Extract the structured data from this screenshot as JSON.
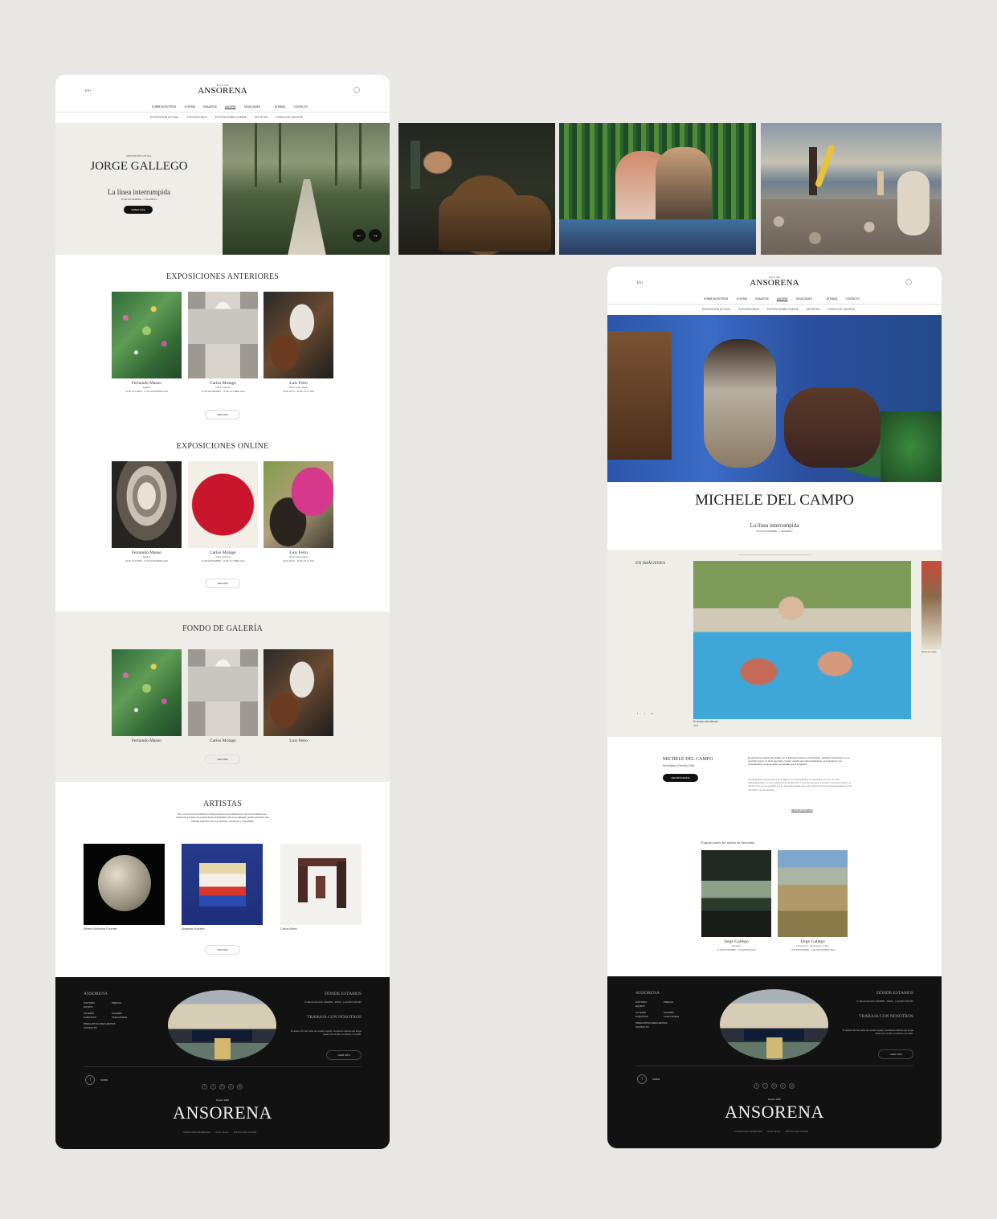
{
  "left_page": {
    "header": {
      "lang": "ES+",
      "logo_small": "SALA DE",
      "logo": "ANSORENA",
      "nav": [
        "SOBRE NOSOTROS",
        "JOYERÍA",
        "SUBASTAS",
        "GALERÍA",
        "TASACIONES",
        "ATIENDA",
        "CONTACTO"
      ],
      "subnav": [
        "EXPOSICIÓN ACTUAL",
        "EXPOSICIONES",
        "EXPOSICIONES ONLINE",
        "ARTISTAS",
        "FONDO DE GALERÍA"
      ]
    },
    "hero": {
      "kicker": "EXPOSICIÓN ACTUAL",
      "artist": "JORGE GALLEGO",
      "title": "La línea interrumpida",
      "dates": "25 DE NOVIEMBRE - 7 DE ENERO",
      "button": "SABER MÁS",
      "prev": "←",
      "next": "→"
    },
    "anteriores": {
      "title": "EXPOSICIONES ANTERIORES",
      "cards": [
        {
          "name": "Fernando Manso",
          "sub": "Agalico",
          "date": "18 DE OCTUBRE - 13 DE NOVIEMBRE 2023"
        },
        {
          "name": "Carlos Motago",
          "sub": "Obra reciente",
          "date": "12 DE SEPTIEMBRE - 13 DE OCTUBRE 2023"
        },
        {
          "name": "Luis Feito",
          "sub": "Obra sobre papel",
          "date": "18 DE MAYO - 30 DE JULIO 2023"
        }
      ],
      "button": "VER MÁS"
    },
    "online": {
      "title": "EXPOSICIONES ONLINE",
      "cards": [
        {
          "name": "Fernando Manso",
          "sub": "Agalico",
          "date": "18 DE OCTUBRE - 13 DE NOVIEMBRE 2023"
        },
        {
          "name": "Carlos Motago",
          "sub": "Obra reciente",
          "date": "12 DE SEPTIEMBRE - 13 DE OCTUBRE 2023"
        },
        {
          "name": "Luis Feito",
          "sub": "Obra sobre papel",
          "date": "18 DE MAYO - 30 DE JULIO 2023"
        }
      ],
      "button": "VER MÁS"
    },
    "fondo": {
      "title": "FONDO DE GALERÍA",
      "cards": [
        {
          "name": "Fernando Manso"
        },
        {
          "name": "Carlos Motago"
        },
        {
          "name": "Luis Feito"
        }
      ],
      "button": "VER MÁS"
    },
    "artistas": {
      "title": "ARTISTAS",
      "intro": "Son numerosos los artistas contemporáneos que colaboraron de forma habitual con Ansorena a través de exposiciones individuales. En este apartado podrá encontrar una cuidada selección de sus pinturas, esculturas y fotografías.",
      "items": [
        "Alberto Bañuelos Fournier",
        "Alejandro Botubol",
        "Carlos Albert"
      ],
      "button": "VER MÁS"
    }
  },
  "footer": {
    "brand": "ANSORENA",
    "links_col1": [
      "HISTORIA",
      "EQUIPO",
      "JOYERÍA",
      "SUBASTAS",
      "PREGUNTAS FRECUENTES",
      "CONTACTO"
    ],
    "links_col2": [
      "PRENSA",
      "GALERÍA",
      "TASACIONES"
    ],
    "where_title": "DÓNDE ESTAMOS",
    "address": "C/ DE ALCALÁ 52, MADRID · 28014 · (+34) 915 328 515",
    "work_title": "TRABAJA CON NOSOTROS",
    "work_text": "Si quieres formar parte de nuestro equipo, buscamos talento que tenga pasión por el arte, la cultura y el estilo.",
    "work_button": "LEER MÁS",
    "up_label": "SUBIR",
    "social": [
      "f",
      "t",
      "in",
      "p",
      "ig"
    ],
    "since": "Desde 1845",
    "logo": "ANSORENA",
    "legal": [
      "CONDICIONES GENERALES",
      "AVISO LEGAL",
      "POLÍTICA DE COOKIES"
    ]
  },
  "right_page": {
    "header": {
      "lang": "ES+",
      "logo_small": "SALA DE",
      "logo": "ANSORENA",
      "nav": [
        "SOBRE NOSOTROS",
        "JOYERÍA",
        "SUBASTAS",
        "GALERÍA",
        "TASACIONES",
        "ATIENDA",
        "CONTACTO"
      ],
      "subnav": [
        "EXPOSICIÓN ACTUAL",
        "EXPOSICIONES",
        "EXPOSICIONES ONLINE",
        "ARTISTAS",
        "FONDO DE GALERÍA"
      ]
    },
    "artist": "MICHELE DEL CAMPO",
    "exhibition": "La línea interrumpida",
    "dates": "25 DE NOVIEMBRE - 7 DE ENERO",
    "images_label": "EN IMÁGENES",
    "caption": "El susurro del silencio",
    "caption_year": "2018",
    "caption2": "Obra sin título",
    "bio_name": "MICHELE DEL CAMPO",
    "bio_place": "Montellano (Sevilla) 1980",
    "bio_button": "VER BIOGRAFÍA",
    "bio_p1": "En general la creación del artista con la figuración siempre contradictoria. Cualquier inmigración es un recorrido impuro en tanto que debe conocer aquello que está integrándose, la inmigración nos procesamiento comprometido con aquello que le emigrante.",
    "bio_p2": "Las dispositivos generadores de imágenes son (los grandes) a integrantes a la con de entre, deshilvanándose, en sus regímenes de destrucción y reproducción de los mundos. Nuestros marcos se transforman en una pantalla que se entiende aquello que mejor alcanzan de los artistas actuales de una naturaleza de desasosiego.",
    "read_more": "SEGUIR LEYENDO",
    "exhibitions_title": "Exposiciones del artista en Ansorena",
    "exhibitions": [
      {
        "name": "Jorge Gallego",
        "sub": "Miradas",
        "date": "17 DE NOVIEMBRE - 7 DE ENERO 2023"
      },
      {
        "name": "Jorge Gallego",
        "sub": "Horizontes · Exposición online",
        "date": "1 DE SEPTIEMBRE - 7 DE SEPTIEMBRE 2023"
      }
    ]
  },
  "colors": {
    "background": "#e9e7e4",
    "beige": "#efede8",
    "footer": "#121212",
    "accent": "#111111"
  }
}
